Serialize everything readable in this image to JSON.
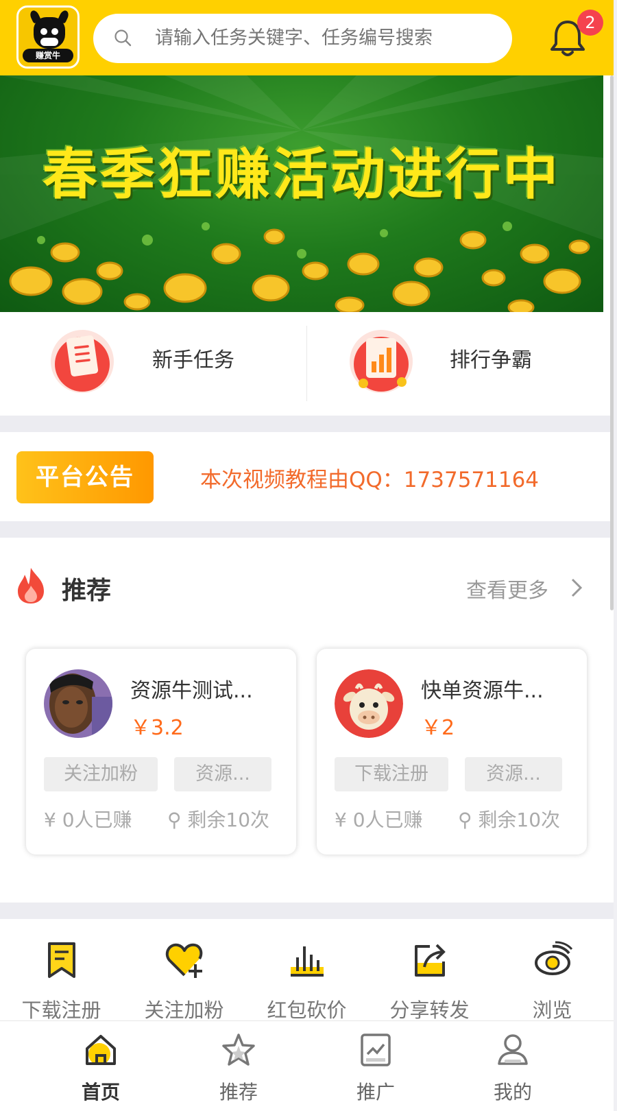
{
  "header": {
    "logo_text": "赚赏牛",
    "search_placeholder": "请输入任务关键字、任务编号搜索",
    "notification_count": "2"
  },
  "banner": {
    "title": "春季狂赚活动进行中"
  },
  "quick_entries": [
    {
      "label": "新手任务",
      "icon": "newbie-task-icon"
    },
    {
      "label": "排行争霸",
      "icon": "ranking-icon"
    }
  ],
  "notice": {
    "tag": "平台公告",
    "text": "本次视频教程由QQ：1737571164"
  },
  "recommend": {
    "title": "推荐",
    "more": "查看更多",
    "cards": [
      {
        "title": "资源牛测试...",
        "price": "￥3.2",
        "tags": [
          "关注加粉",
          "资源..."
        ],
        "earned": "0人已赚",
        "remaining": "剩余10次",
        "avatar": "portrait-avatar"
      },
      {
        "title": "快单资源牛...",
        "price": "￥2",
        "tags": [
          "下载注册",
          "资源..."
        ],
        "earned": "0人已赚",
        "remaining": "剩余10次",
        "avatar": "cow-avatar"
      }
    ]
  },
  "categories": [
    {
      "label": "下载注册",
      "icon": "download-register-icon"
    },
    {
      "label": "关注加粉",
      "icon": "follow-heart-icon"
    },
    {
      "label": "红包砍价",
      "icon": "bargain-chart-icon"
    },
    {
      "label": "分享转发",
      "icon": "share-forward-icon"
    },
    {
      "label": "浏览",
      "icon": "browse-eye-icon"
    }
  ],
  "tabbar": [
    {
      "label": "首页",
      "icon": "home-icon",
      "active": true
    },
    {
      "label": "推荐",
      "icon": "star-icon",
      "active": false
    },
    {
      "label": "推广",
      "icon": "promote-icon",
      "active": false
    },
    {
      "label": "我的",
      "icon": "user-icon",
      "active": false
    }
  ],
  "colors": {
    "header": "#ffd000",
    "accent": "#ff6a1a",
    "notice_text": "#f26a2b",
    "badge": "#f5424e"
  }
}
